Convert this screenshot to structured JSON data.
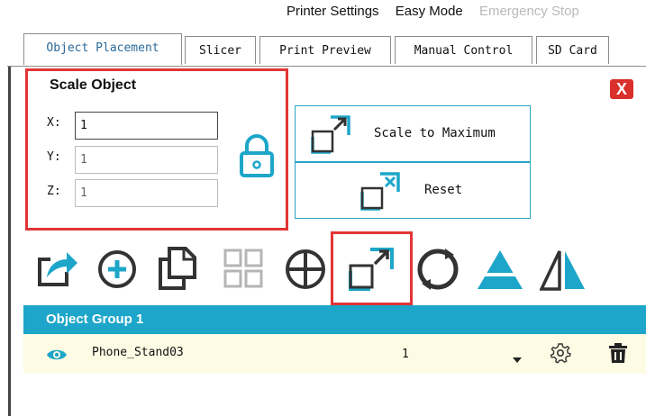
{
  "top_menu": {
    "printer_settings": "Printer Settings",
    "easy_mode": "Easy Mode",
    "emergency_stop": "Emergency Stop"
  },
  "tabs": [
    {
      "label": "Object Placement",
      "active": true
    },
    {
      "label": "Slicer",
      "active": false
    },
    {
      "label": "Print Preview",
      "active": false
    },
    {
      "label": "Manual Control",
      "active": false
    },
    {
      "label": "SD Card",
      "active": false
    }
  ],
  "scale_panel": {
    "title": "Scale Object",
    "x_label": "X:",
    "x_value": "1",
    "y_label": "Y:",
    "y_value": "1",
    "z_label": "Z:",
    "z_value": "1",
    "lock_icon": "padlock-icon",
    "close_label": "X"
  },
  "actions": {
    "scale_to_max_label": "Scale to Maximum",
    "reset_label": "Reset"
  },
  "toolbar_icons": [
    "import-icon",
    "add-icon",
    "copy-icon",
    "grid-arrange-icon",
    "center-icon",
    "scale-icon",
    "rotate-icon",
    "cut-icon",
    "mirror-icon"
  ],
  "object_list": {
    "group_name": "Object Group 1",
    "objects": [
      {
        "name": "Phone_Stand03",
        "copies": "1",
        "visible": true
      }
    ]
  },
  "colors": {
    "accent": "#1da6c9",
    "highlight": "#e23535",
    "row_background": "#fdfbe4",
    "close_button": "#d9302c"
  }
}
